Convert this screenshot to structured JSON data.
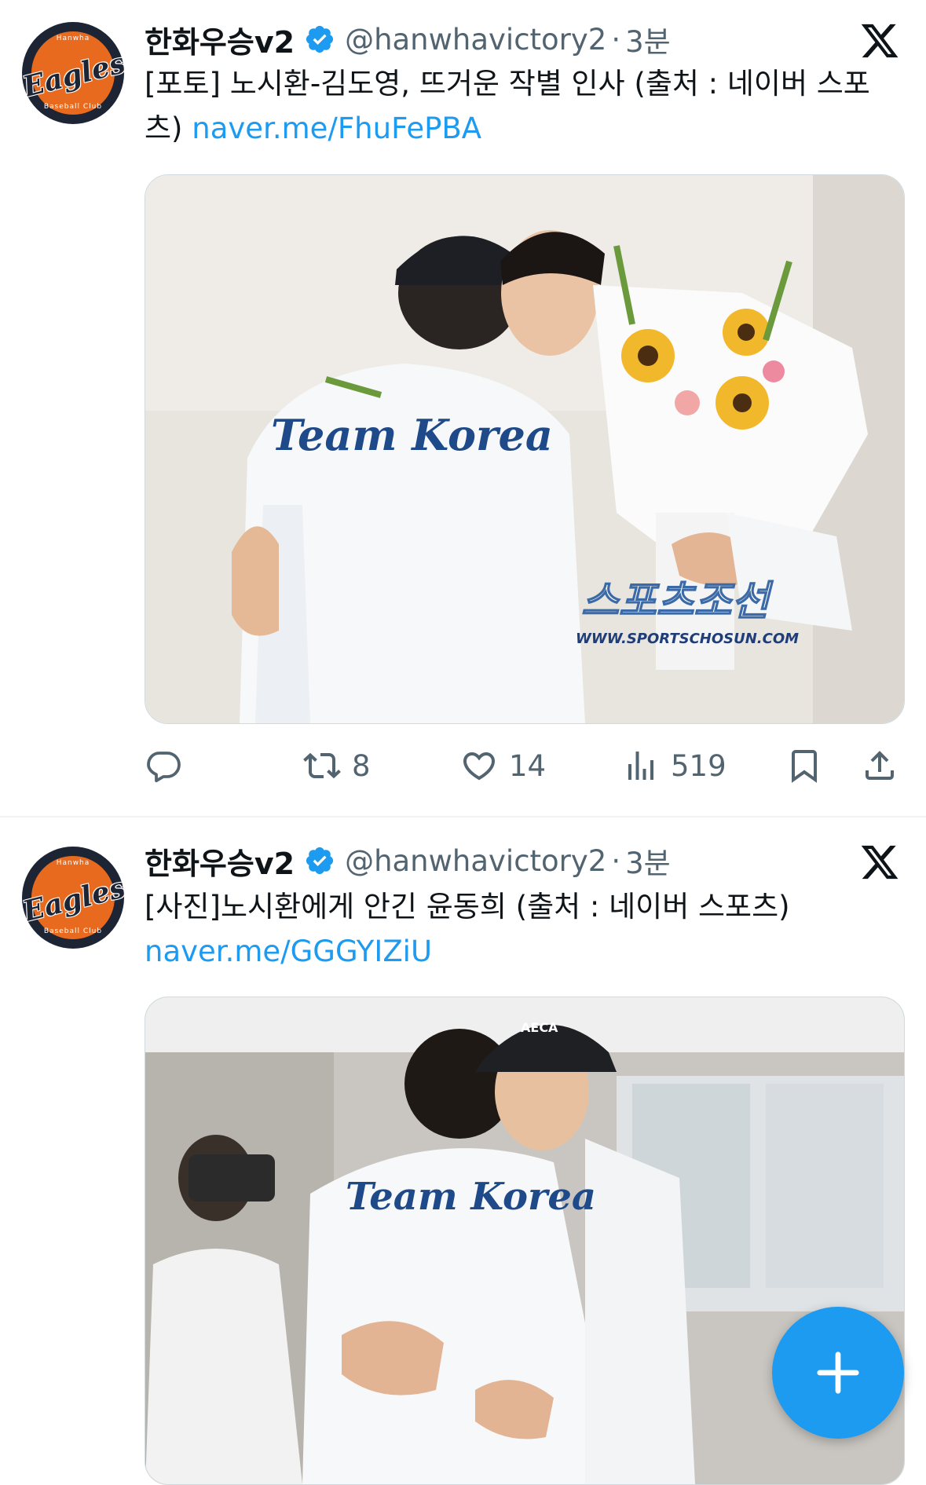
{
  "tweets": [
    {
      "display_name": "한화우승v2",
      "handle": "@hanwhavictory2",
      "separator": "·",
      "time": "3분",
      "text": "[포토] 노시환-김도영, 뜨거운 작별 인사 (출처 : 네이버 스포츠)",
      "link": "naver.me/FhuFePBA",
      "photo": {
        "jacket_text": "Team Korea",
        "watermark_brand": "스포츠조선",
        "watermark_url": "WWW.SPORTSCHOSUN.COM"
      },
      "actions": {
        "reply": "",
        "retweet": "8",
        "like": "14",
        "views": "519"
      }
    },
    {
      "display_name": "한화우승v2",
      "handle": "@hanwhavictory2",
      "separator": "·",
      "time": "3분",
      "text": "[사진]노시환에게 안긴 윤동희 (출처 : 네이버 스포츠)",
      "link": "naver.me/GGGYIZiU",
      "photo": {
        "jacket_text": "Team Korea",
        "cap_text": "AECA"
      }
    }
  ],
  "avatar": {
    "logo_text": "Eagles",
    "ring_top": "Hanwha",
    "ring_bottom": "Baseball Club"
  },
  "icons": {
    "verified": "verified-badge-icon",
    "platform": "x-logo-icon",
    "reply": "reply-icon",
    "retweet": "retweet-icon",
    "like": "heart-icon",
    "views": "views-icon",
    "bookmark": "bookmark-icon",
    "share": "share-icon",
    "compose": "compose-plus-icon"
  },
  "colors": {
    "accent": "#1d9bf0",
    "text_primary": "#0f1419",
    "text_secondary": "#536471",
    "avatar_orange": "#e86a1e",
    "avatar_navy": "#1d2434"
  }
}
